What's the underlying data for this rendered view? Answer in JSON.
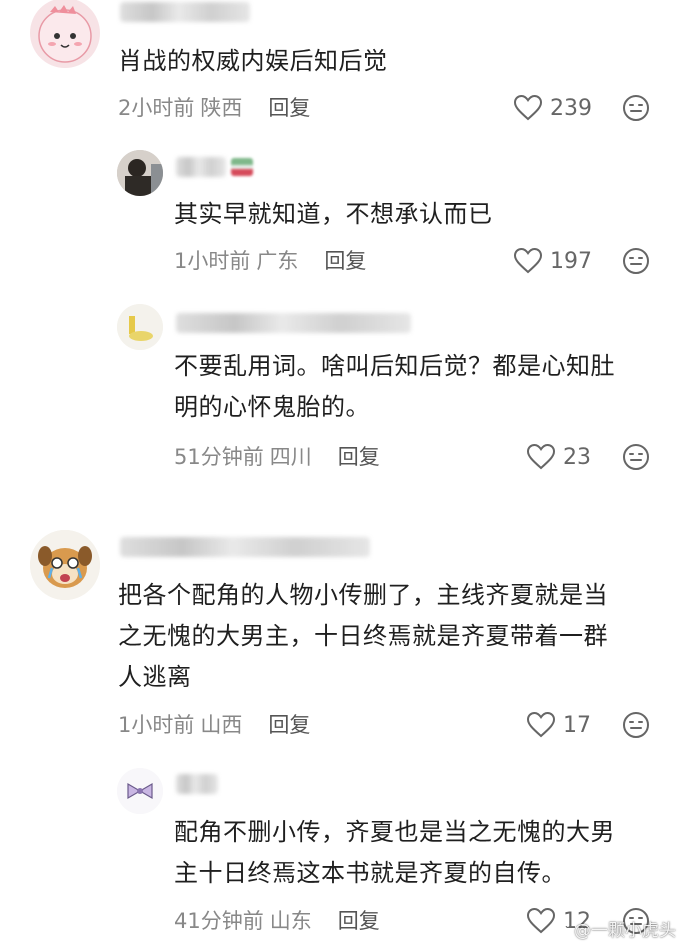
{
  "comments": [
    {
      "text": "肖战的权威内娱后知后觉",
      "time": "2小时前",
      "region": "陕西",
      "reply_label": "回复",
      "likes": "239"
    },
    {
      "text": "其实早就知道，不想承认而已",
      "time": "1小时前",
      "region": "广东",
      "reply_label": "回复",
      "likes": "197"
    },
    {
      "text": "不要乱用词。啥叫后知后觉？都是心知肚\n明的心怀鬼胎的。",
      "time": "51分钟前",
      "region": "四川",
      "reply_label": "回复",
      "likes": "23"
    },
    {
      "text": "把各个配角的人物小传删了，主线齐夏就是当\n之无愧的大男主，十日终焉就是齐夏带着一群\n人逃离",
      "time": "1小时前",
      "region": "山西",
      "reply_label": "回复",
      "likes": "17"
    },
    {
      "text": "配角不删小传，齐夏也是当之无愧的大男\n主十日终焉这本书就是齐夏的自传。",
      "time": "41分钟前",
      "region": "山东",
      "reply_label": "回复",
      "likes": "12"
    }
  ],
  "watermark": "@一颗小虎头",
  "colors": {
    "text": "#1f1f1f",
    "meta": "#888888",
    "icon": "#666666"
  }
}
